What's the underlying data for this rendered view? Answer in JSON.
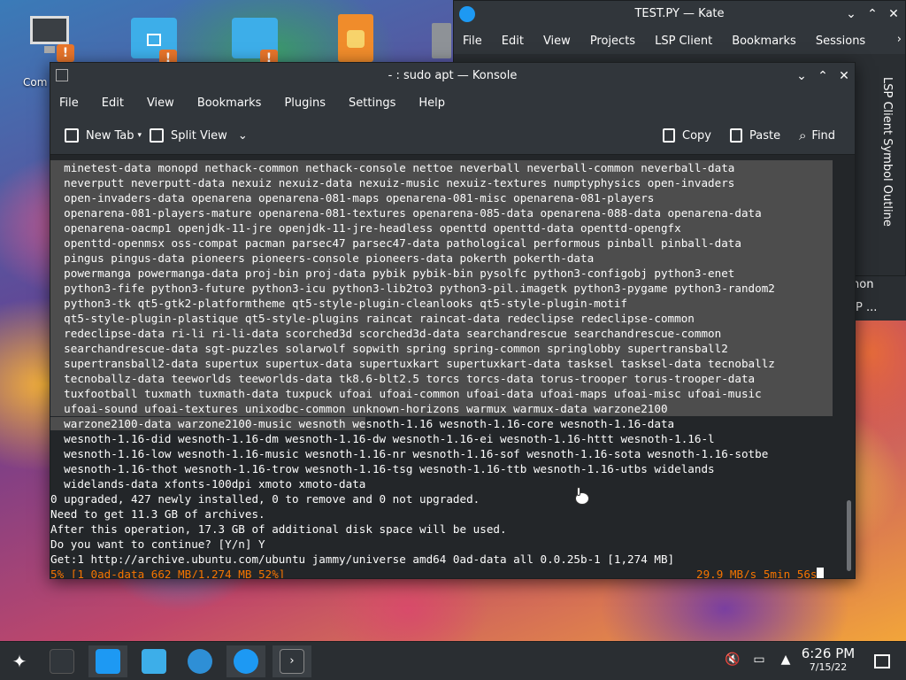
{
  "desktop": {
    "icons": [
      {
        "name": "computer",
        "label": "Com"
      },
      {
        "name": "home-folder",
        "label": ""
      },
      {
        "name": "network-folder",
        "label": ""
      },
      {
        "name": "python-file",
        "label": ""
      },
      {
        "name": "trash",
        "label": ""
      }
    ]
  },
  "kate": {
    "title": "TEST.PY — Kate",
    "menu": [
      "File",
      "Edit",
      "View",
      "Projects",
      "LSP Client",
      "Bookmarks",
      "Sessions"
    ],
    "side_panel_label": "LSP Client Symbol Outline",
    "partial_1": "non",
    "partial_2": "P ..."
  },
  "konsole": {
    "title": "- : sudo apt — Konsole",
    "menu": [
      "File",
      "Edit",
      "View",
      "Bookmarks",
      "Plugins",
      "Settings",
      "Help"
    ],
    "toolbar": {
      "new_tab": "New Tab",
      "split_view": "Split View",
      "copy": "Copy",
      "paste": "Paste",
      "find": "Find"
    },
    "selected_lines": [
      "  minetest-data monopd nethack-common nethack-console nettoe neverball neverball-common neverball-data",
      "  neverputt neverputt-data nexuiz nexuiz-data nexuiz-music nexuiz-textures numptyphysics open-invaders",
      "  open-invaders-data openarena openarena-081-maps openarena-081-misc openarena-081-players",
      "  openarena-081-players-mature openarena-081-textures openarena-085-data openarena-088-data openarena-data",
      "  openarena-oacmp1 openjdk-11-jre openjdk-11-jre-headless openttd openttd-data openttd-opengfx",
      "  openttd-openmsx oss-compat pacman parsec47 parsec47-data pathological performous pinball pinball-data",
      "  pingus pingus-data pioneers pioneers-console pioneers-data pokerth pokerth-data",
      "  powermanga powermanga-data proj-bin proj-data pybik pybik-bin pysolfc python3-configobj python3-enet",
      "  python3-fife python3-future python3-icu python3-lib2to3 python3-pil.imagetk python3-pygame python3-random2",
      "  python3-tk qt5-gtk2-platformtheme qt5-style-plugin-cleanlooks qt5-style-plugin-motif",
      "  qt5-style-plugin-plastique qt5-style-plugins raincat raincat-data redeclipse redeclipse-common",
      "  redeclipse-data ri-li ri-li-data scorched3d scorched3d-data searchandrescue searchandrescue-common",
      "  searchandrescue-data sgt-puzzles solarwolf sopwith spring spring-common springlobby supertransball2",
      "  supertransball2-data supertux supertux-data supertuxkart supertuxkart-data tasksel tasksel-data tecnoballz",
      "  tecnoballz-data teeworlds teeworlds-data tk8.6-blt2.5 torcs torcs-data torus-trooper torus-trooper-data",
      "  tuxfootball tuxmath tuxmath-data tuxpuck ufoai ufoai-common ufoai-data ufoai-maps ufoai-misc ufoai-music",
      "  ufoai-sound ufoai-textures unixodbc-common unknown-horizons warmux warmux-data warzone2100"
    ],
    "partial_selected": "  warzone2100-data warzone2100-music wesnoth we",
    "partial_rest": "snoth-1.16 wesnoth-1.16-core wesnoth-1.16-data",
    "lines": [
      "  wesnoth-1.16-did wesnoth-1.16-dm wesnoth-1.16-dw wesnoth-1.16-ei wesnoth-1.16-httt wesnoth-1.16-l",
      "  wesnoth-1.16-low wesnoth-1.16-music wesnoth-1.16-nr wesnoth-1.16-sof wesnoth-1.16-sota wesnoth-1.16-sotbe",
      "  wesnoth-1.16-thot wesnoth-1.16-trow wesnoth-1.16-tsg wesnoth-1.16-ttb wesnoth-1.16-utbs widelands",
      "  widelands-data xfonts-100dpi xmoto xmoto-data",
      "0 upgraded, 427 newly installed, 0 to remove and 0 not upgraded.",
      "Need to get 11.3 GB of archives.",
      "After this operation, 17.3 GB of additional disk space will be used.",
      "Do you want to continue? [Y/n] Y",
      "Get:1 http://archive.ubuntu.com/ubuntu jammy/universe amd64 0ad-data all 0.0.25b-1 [1,274 MB]"
    ],
    "progress_left": "5% [1 0ad-data 662 MB/1,274 MB 52%]",
    "progress_right": "29.9 MB/s 5min 56s"
  },
  "taskbar": {
    "time": "6:26 PM",
    "date": "7/15/22"
  }
}
